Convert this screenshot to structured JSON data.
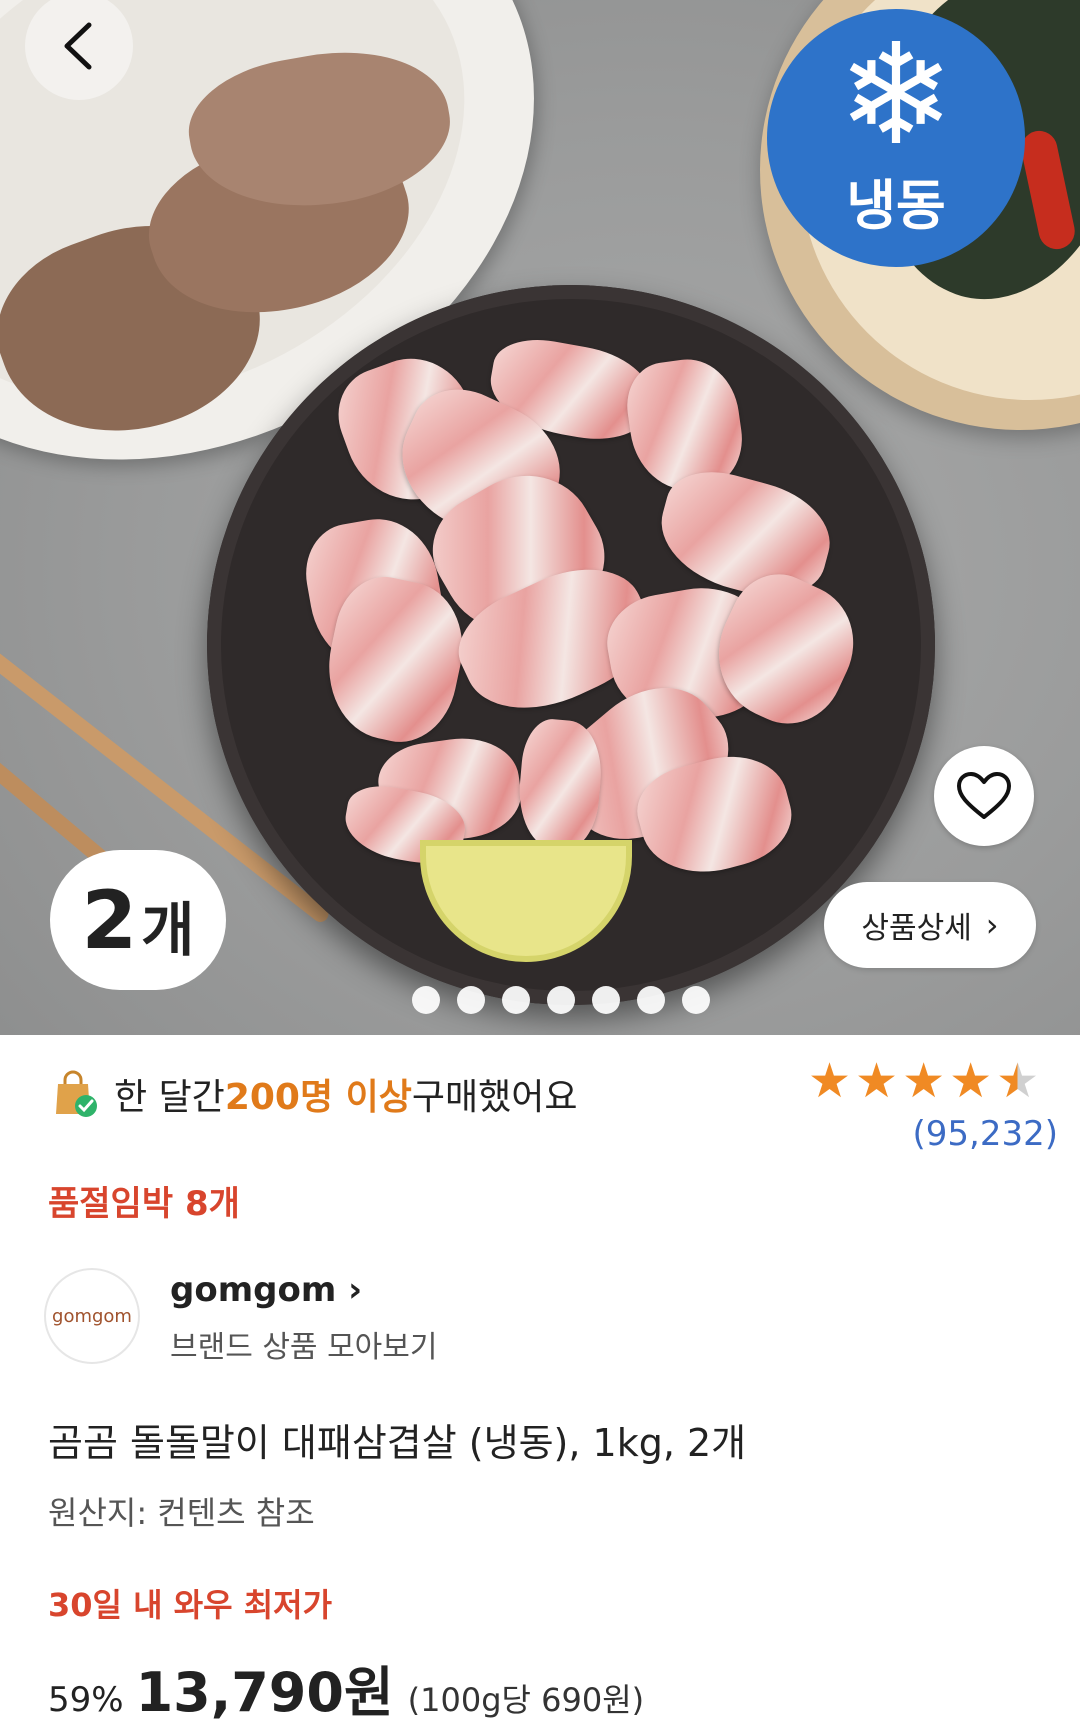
{
  "hero": {
    "frozen_badge": "냉동",
    "quantity": "2",
    "quantity_unit": "개",
    "detail_button": "상품상세",
    "image_count": 7
  },
  "purchase": {
    "prefix": "한 달간 ",
    "highlight": "200명 이상",
    "suffix": " 구매했어요"
  },
  "rating": {
    "stars": 4.5,
    "review_count": "(95,232)"
  },
  "stock_warning": "품절임박 8개",
  "brand": {
    "logo_text": "gomgom",
    "name": "gomgom",
    "sub": "브랜드 상품 모아보기"
  },
  "product": {
    "title": "곰곰 돌돌말이 대패삼겹살 (냉동), 1kg, 2개",
    "origin": "원산지: 컨텐츠 참조"
  },
  "price": {
    "lowest_label": "30일 내 와우 최저가",
    "discount": "59%",
    "amount": "13,790원",
    "unit_price": "(100g당 690원)"
  },
  "colors": {
    "accent_orange": "#e07a1a",
    "warning_red": "#d8452d",
    "link_blue": "#3c6bc4",
    "star": "#f08a24",
    "frozen_blue": "#2e73c9"
  }
}
